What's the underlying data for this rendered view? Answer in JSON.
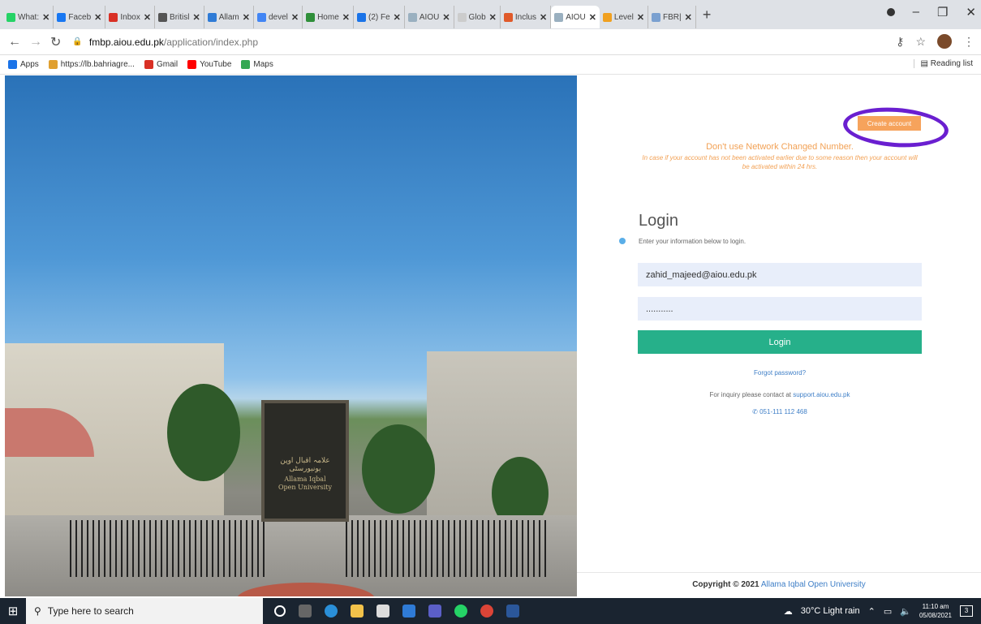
{
  "browser": {
    "tabs": [
      {
        "label": "What:",
        "icon": "whatsapp-icon",
        "color": "#25d366"
      },
      {
        "label": "Faceb",
        "icon": "facebook-icon",
        "color": "#1877f2"
      },
      {
        "label": "Inbox",
        "icon": "gmail-icon",
        "color": "#d93025"
      },
      {
        "label": "Britisl",
        "icon": "globe-icon",
        "color": "#555555"
      },
      {
        "label": "Allam",
        "icon": "doc-icon",
        "color": "#2f7bd6"
      },
      {
        "label": "devel",
        "icon": "google-icon",
        "color": "#4285f4"
      },
      {
        "label": "Home",
        "icon": "aiou-icon",
        "color": "#2f8f3a"
      },
      {
        "label": "(2) Fe",
        "icon": "calendar-icon",
        "color": "#1a73e8"
      },
      {
        "label": "AIOU",
        "icon": "aiou-icon",
        "color": "#9ab0c0"
      },
      {
        "label": "Glob",
        "icon": "blank-icon",
        "color": "#cccccc"
      },
      {
        "label": "Inclus",
        "icon": "inclusion-icon",
        "color": "#e05a2a"
      },
      {
        "label": "AIOU",
        "icon": "aiou-icon",
        "color": "#9ab0c0",
        "active": true
      },
      {
        "label": "Level",
        "icon": "level-icon",
        "color": "#f0a020"
      },
      {
        "label": "FBR|",
        "icon": "doc-icon",
        "color": "#7aa0d0"
      }
    ],
    "tab_close": "✕",
    "new_tab": "+",
    "url_host": "fmbp.aiou.edu.pk",
    "url_path": "/application/index.php",
    "bookmarks": [
      {
        "label": "Apps",
        "color": "#1a73e8"
      },
      {
        "label": "https://lb.bahriagre...",
        "color": "#e0a030"
      },
      {
        "label": "Gmail",
        "color": "#d93025"
      },
      {
        "label": "YouTube",
        "color": "#ff0000"
      },
      {
        "label": "Maps",
        "color": "#34a853"
      }
    ],
    "reading_list": "Reading list"
  },
  "hero": {
    "gate_text_urdu": "علامہ اقبال اوپن یونیورسٹی",
    "gate_text_en_1": "Allama Iqbal",
    "gate_text_en_2": "Open University",
    "colors": {
      "sky": "#2a72b8"
    }
  },
  "panel": {
    "create_account": "Create account",
    "warning_title": "Don't use Network Changed Number.",
    "warning_body": "In case if your account has not been activated earlier due to some reason then your account will be activated within 24 hrs.",
    "login_title": "Login",
    "login_subtitle": "Enter your information below to login.",
    "email_value": "zahid_majeed@aiou.edu.pk",
    "password_value": "...........",
    "login_button": "Login",
    "forgot_password": "Forgot password?",
    "inquiry_text": "For inquiry please contact at ",
    "inquiry_link": "support.aiou.edu.pk",
    "phone": "051-111 112 468",
    "copyright_prefix": "Copyright © 2021",
    "copyright_org": "Allama Iqbal Open University",
    "colors": {
      "create": "#f6a35c",
      "login": "#26b08a",
      "link": "#3f7fc7",
      "warning": "#f2a155",
      "annotation": "#6a1fd0"
    }
  },
  "taskbar": {
    "search_placeholder": "Type here to search",
    "weather": "30°C  Light rain",
    "time": "11:10 am",
    "date": "05/08/2021",
    "notifications": "3"
  }
}
